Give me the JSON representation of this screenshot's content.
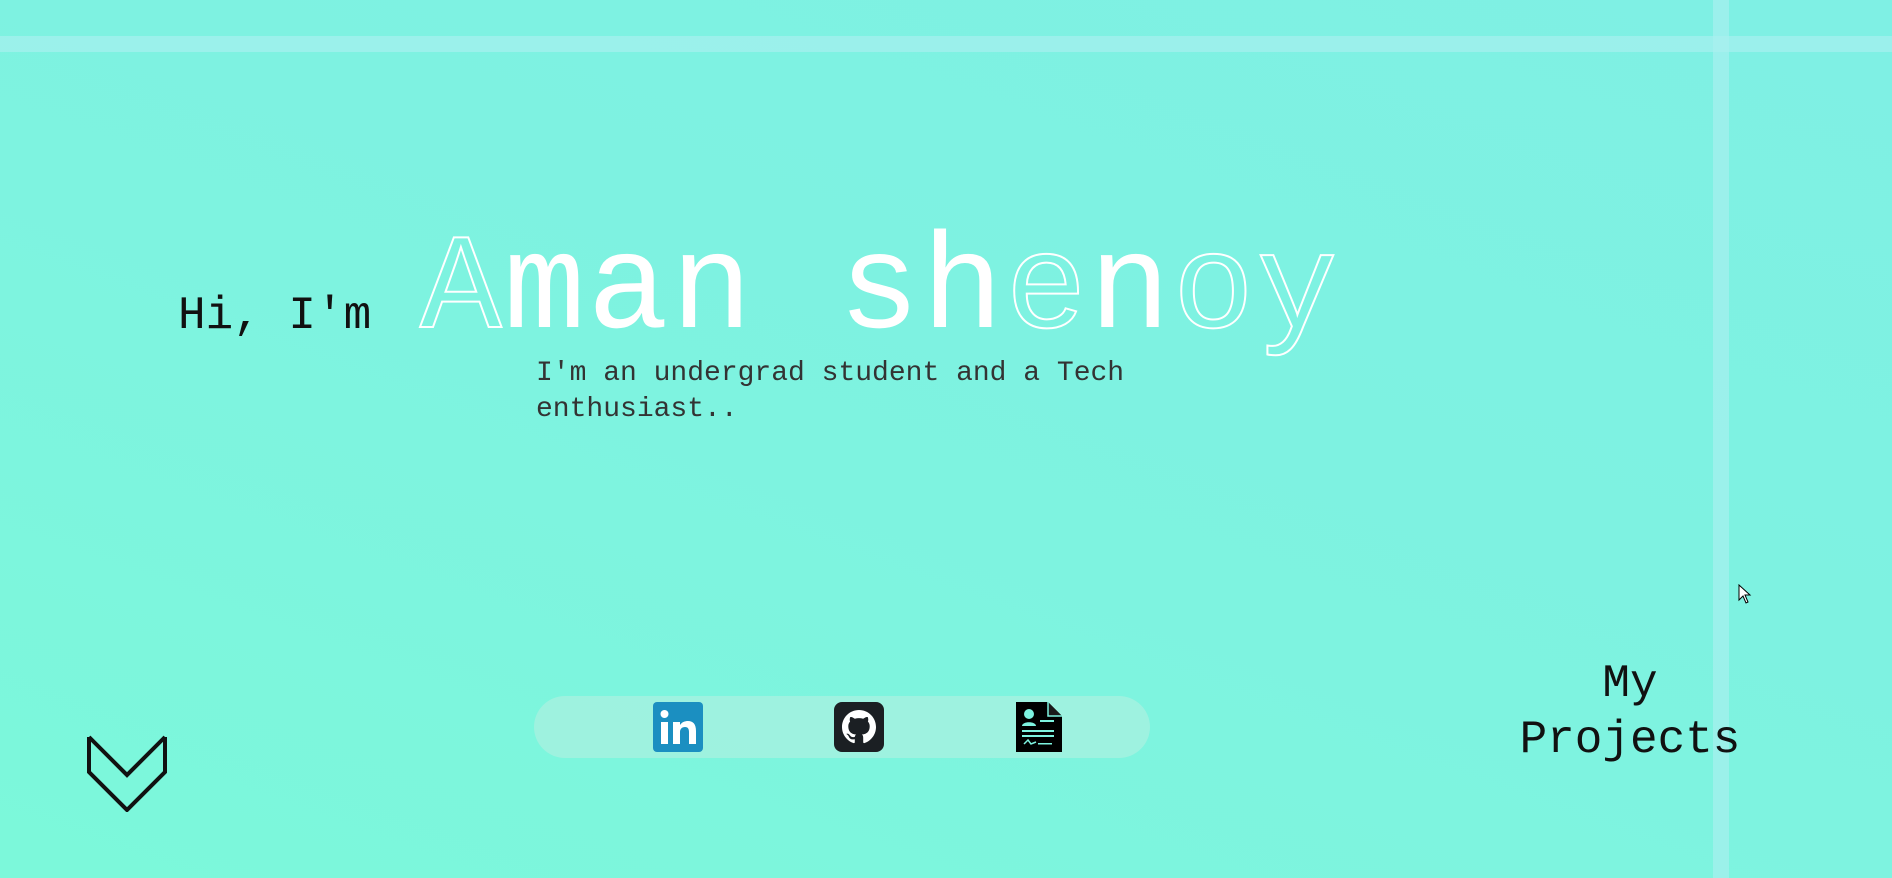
{
  "hero": {
    "greeting": "Hi, I'm",
    "name": "Aman shenoy",
    "tagline": "I'm an undergrad student and a Tech enthusiast.."
  },
  "social": [
    {
      "icon": "linkedin-icon",
      "label": "in",
      "color": "#1b8fc1"
    },
    {
      "icon": "github-icon",
      "color": "#1b1f23"
    },
    {
      "icon": "resume-icon",
      "color": "#000000"
    }
  ],
  "nav": {
    "projects_label_line1": "My",
    "projects_label_line2": "Projects"
  },
  "icons": {
    "scroll_down": "double-chevron-down-icon",
    "cursor": "mouse-pointer-icon"
  },
  "colors": {
    "background": "#7ef3e0",
    "name_text": "#ffffff",
    "text": "#111111"
  }
}
